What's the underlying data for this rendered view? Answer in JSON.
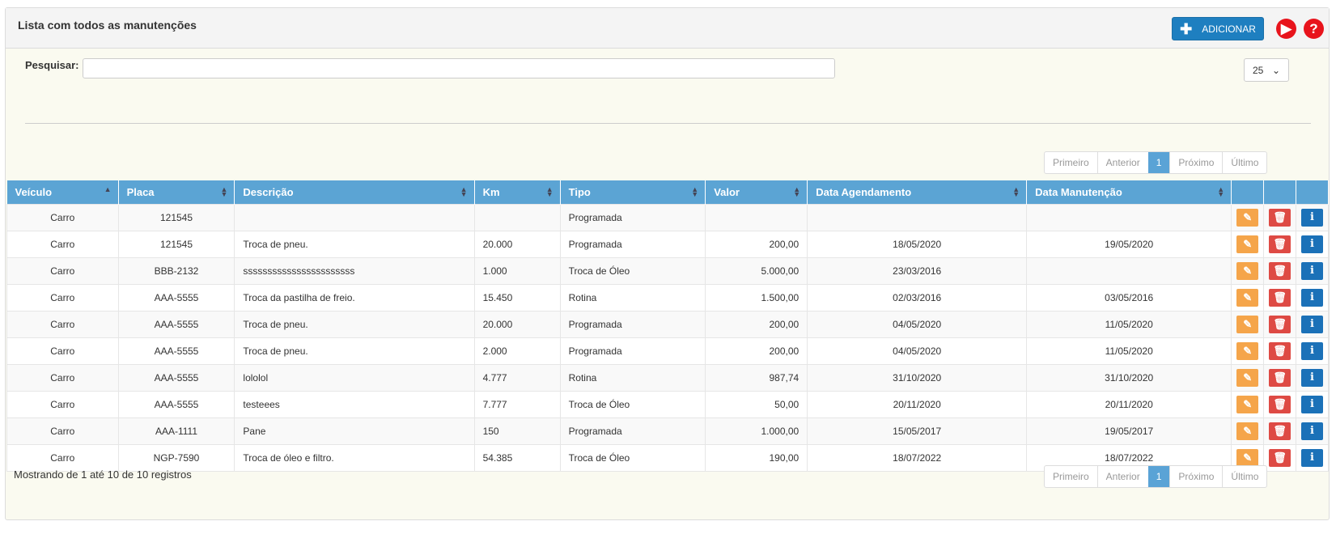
{
  "panel": {
    "title": "Lista com todos as manutenções"
  },
  "header": {
    "add_label": "ADICIONAR",
    "play_icon": "play-icon",
    "help_icon": "help-icon"
  },
  "search": {
    "label": "Pesquisar:",
    "value": "",
    "placeholder": ""
  },
  "page_size": {
    "selected": "25"
  },
  "pagination": {
    "first": "Primeiro",
    "prev": "Anterior",
    "current": "1",
    "next": "Próximo",
    "last": "Último"
  },
  "columns": [
    "Veículo",
    "Placa",
    "Descrição",
    "Km",
    "Tipo",
    "Valor",
    "Data Agendamento",
    "Data Manutenção"
  ],
  "rows": [
    [
      "Carro",
      "121545",
      "",
      "",
      "Programada",
      "",
      "",
      ""
    ],
    [
      "Carro",
      "121545",
      "Troca de pneu.",
      "20.000",
      "Programada",
      "200,00",
      "18/05/2020",
      "19/05/2020"
    ],
    [
      "Carro",
      "BBB-2132",
      "sssssssssssssssssssssss",
      "1.000",
      "Troca de Óleo",
      "5.000,00",
      "23/03/2016",
      ""
    ],
    [
      "Carro",
      "AAA-5555",
      "Troca da pastilha de freio.",
      "15.450",
      "Rotina",
      "1.500,00",
      "02/03/2016",
      "03/05/2016"
    ],
    [
      "Carro",
      "AAA-5555",
      "Troca de pneu.",
      "20.000",
      "Programada",
      "200,00",
      "04/05/2020",
      "11/05/2020"
    ],
    [
      "Carro",
      "AAA-5555",
      "Troca de pneu.",
      "2.000",
      "Programada",
      "200,00",
      "04/05/2020",
      "11/05/2020"
    ],
    [
      "Carro",
      "AAA-5555",
      "lololol",
      "4.777",
      "Rotina",
      "987,74",
      "31/10/2020",
      "31/10/2020"
    ],
    [
      "Carro",
      "AAA-5555",
      "testeees",
      "7.777",
      "Troca de Óleo",
      "50,00",
      "20/11/2020",
      "20/11/2020"
    ],
    [
      "Carro",
      "AAA-1111",
      "Pane",
      "150",
      "Programada",
      "1.000,00",
      "15/05/2017",
      "19/05/2017"
    ],
    [
      "Carro",
      "NGP-7590",
      "Troca de óleo e filtro.",
      "54.385",
      "Troca de Óleo",
      "190,00",
      "18/07/2022",
      "18/07/2022"
    ]
  ],
  "footer": {
    "info": "Mostrando de 1 até 10 de 10 registros"
  },
  "colors": {
    "header_blue": "#5ba4d4",
    "edit": "#f5a54a",
    "delete": "#de4a44",
    "info": "#1b71b8",
    "add": "#1e7fc0"
  }
}
